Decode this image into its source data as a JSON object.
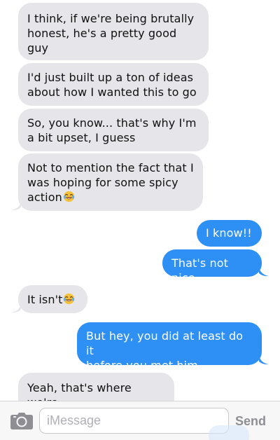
{
  "messages": [
    {
      "side": "received",
      "text": "I think, if we're being brutally\nhonest, he's a pretty good guy"
    },
    {
      "side": "received",
      "text": "I'd just built up a ton of ideas\nabout how I wanted this to go"
    },
    {
      "side": "received",
      "text": "So, you know... that's why I'm\na bit upset, I guess"
    },
    {
      "side": "received",
      "text": "Not to mention the fact that I\nwas hoping for some spicy\naction",
      "emoji": "laughing-tears-emoji"
    },
    {
      "side": "sent",
      "text": "I know!!"
    },
    {
      "side": "sent",
      "text": "That's not nice"
    },
    {
      "side": "received",
      "text": "It isn't",
      "emoji": "laughing-tears-emoji"
    },
    {
      "side": "sent",
      "text": "But hey, you did at least do it\nbefore you met him"
    },
    {
      "side": "received",
      "text": "Yeah, that's where we're\ndifferent, isn't it?"
    }
  ],
  "composer": {
    "camera_icon": "camera-icon",
    "placeholder": "iMessage",
    "send_label": "Send"
  },
  "colors": {
    "received_bubble": "#e5e5ea",
    "sent_bubble": "#2e8ff5",
    "send_disabled": "#8e8e93"
  }
}
